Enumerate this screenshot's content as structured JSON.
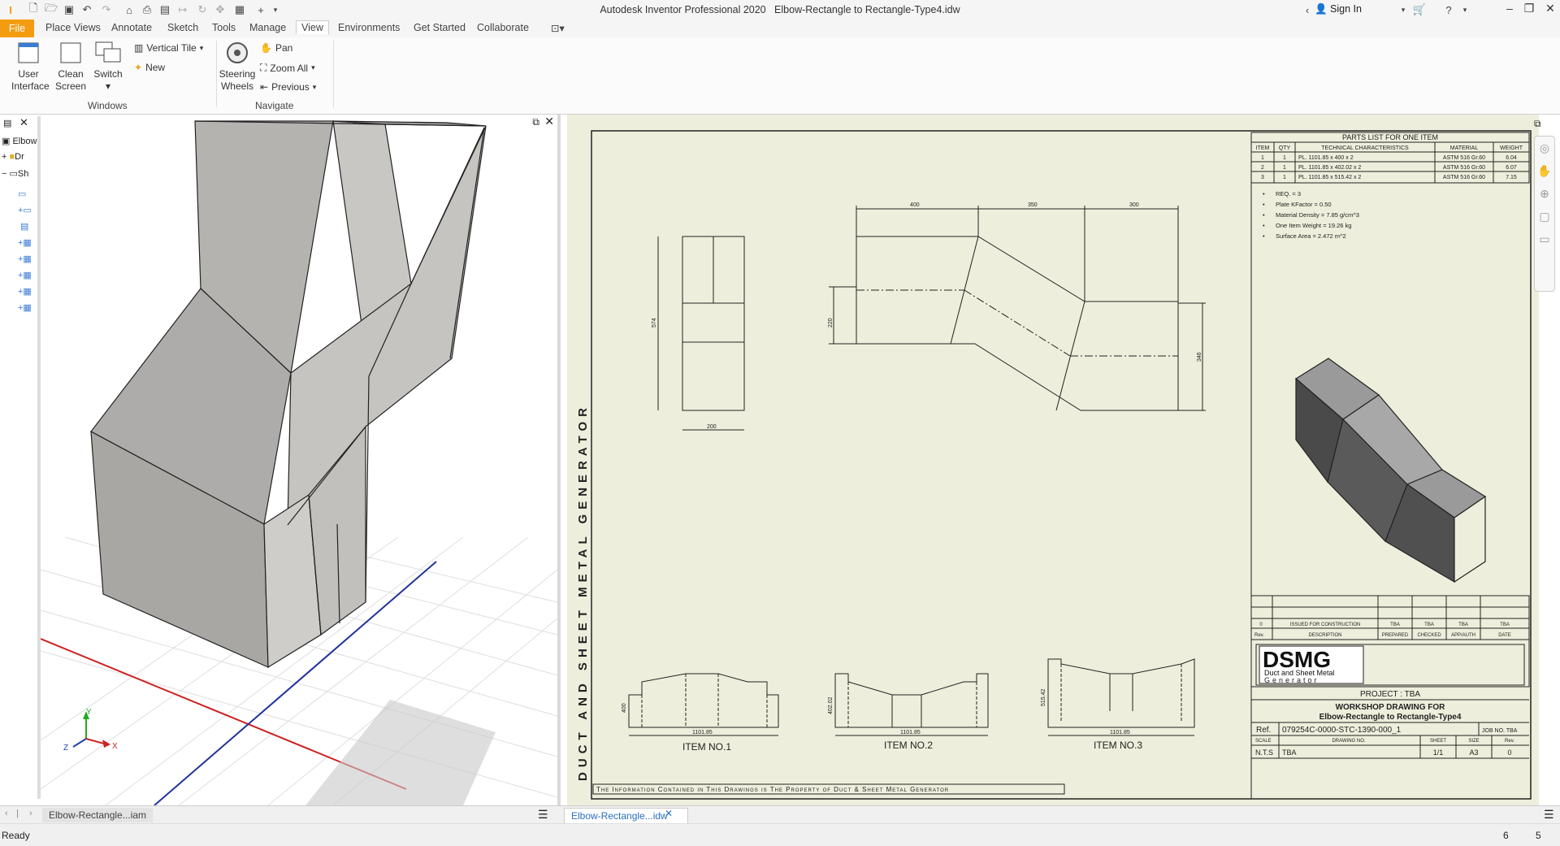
{
  "window": {
    "app_title": "Autodesk Inventor Professional 2020",
    "doc_title": "Elbow-Rectangle to Rectangle-Type4.idw",
    "sign_in": "Sign In"
  },
  "tabs": [
    "File",
    "Place Views",
    "Annotate",
    "Sketch",
    "Tools",
    "Manage",
    "View",
    "Environments",
    "Get Started",
    "Collaborate"
  ],
  "ribbon": {
    "user_interface": "User Interface",
    "user_interface_l1": "User",
    "user_interface_l2": "Interface",
    "clean_screen_l1": "Clean",
    "clean_screen_l2": "Screen",
    "switch": "Switch",
    "vertical_tile": "Vertical Tile",
    "new": "New",
    "windows_group": "Windows",
    "steering_l1": "Steering",
    "steering_l2": "Wheels",
    "pan": "Pan",
    "zoom_all": "Zoom All",
    "previous": "Previous",
    "navigate_group": "Navigate"
  },
  "browser": {
    "items": [
      "Elbow",
      "Dr",
      "Sh"
    ]
  },
  "drawing": {
    "side_title": "DUCT AND SHEET METAL GENERATOR",
    "parts_list": {
      "title": "PARTS LIST FOR ONE ITEM",
      "headers": [
        "ITEM",
        "QTY",
        "TECHNICAL CHARACTERISTICS",
        "MATERIAL",
        "WEIGHT"
      ],
      "rows": [
        [
          "1",
          "1",
          "PL. 1101.85 x 400 x 2",
          "ASTM 516 Gr.60",
          "6.04"
        ],
        [
          "2",
          "1",
          "PL. 1101.85 x 402.02 x 2",
          "ASTM 516 Gr.60",
          "6.07"
        ],
        [
          "3",
          "1",
          "PL. 1101.85 x 515.42 x 2",
          "ASTM 516 Gr.60",
          "7.15"
        ]
      ]
    },
    "notes": [
      "REQ. = 3",
      "Plate KFactor = 0.50",
      "Material Density = 7.85 g/cm^3",
      "One Item Weight = 19.26 kg",
      "Surface Area = 2.472 m^2"
    ],
    "dims": {
      "d400": "400",
      "d350": "350",
      "d300": "300",
      "d220": "220",
      "d346": "346",
      "d574": "574",
      "d200": "200",
      "i1_h": "400",
      "i1_w": "1101.85",
      "i2_h": "402.02",
      "i2_w": "1101.85",
      "i3_h": "515.42",
      "i3_w": "1101.85"
    },
    "items": [
      "ITEM NO.1",
      "ITEM NO.2",
      "ITEM NO.3"
    ],
    "revision": {
      "rev0": "0",
      "rev0_desc": "ISSUED FOR CONSTRUCTION",
      "tba": "TBA",
      "rev_label": "Rev.",
      "description": "DESCRIPTION",
      "prepared": "PREPARED",
      "checked": "CHECKED",
      "approved": "APP/AUTH",
      "date": "DATE"
    },
    "logo": {
      "big": "DSMG",
      "line1": "Duct and Sheet Metal",
      "line2": "Generator"
    },
    "project": "PROJECT : TBA",
    "workshop_l1": "WORKSHOP DRAWING FOR",
    "workshop_l2": "Elbow-Rectangle to Rectangle-Type4",
    "ref_label": "Ref.",
    "ref_value": "079254C-0000-STC-1390-000_1",
    "job_no": "JOB NO. TBA",
    "scale_label": "SCALE",
    "drawing_no_label": "DRAWING NO.",
    "sheet_label": "SHEET",
    "size_label": "SIZE",
    "rev_label2": "Rev.",
    "scale": "N.T.S",
    "drawing_no": "TBA",
    "sheet": "1/1",
    "size": "A3",
    "rev": "0",
    "footer": "The Information Contained in This Drawings is The Property of Duct & Sheet Metal Generator"
  },
  "doc_tabs": [
    "Elbow-Rectangle...iam",
    "Elbow-Rectangle...idw"
  ],
  "status": {
    "ready": "Ready",
    "n1": "6",
    "n2": "5"
  },
  "colors": {
    "file_tab": "#f39c12",
    "sheet_bg": "#eeeedc",
    "axis_x": "#cc2222",
    "axis_y": "#22aa22",
    "axis_z": "#2244aa"
  }
}
